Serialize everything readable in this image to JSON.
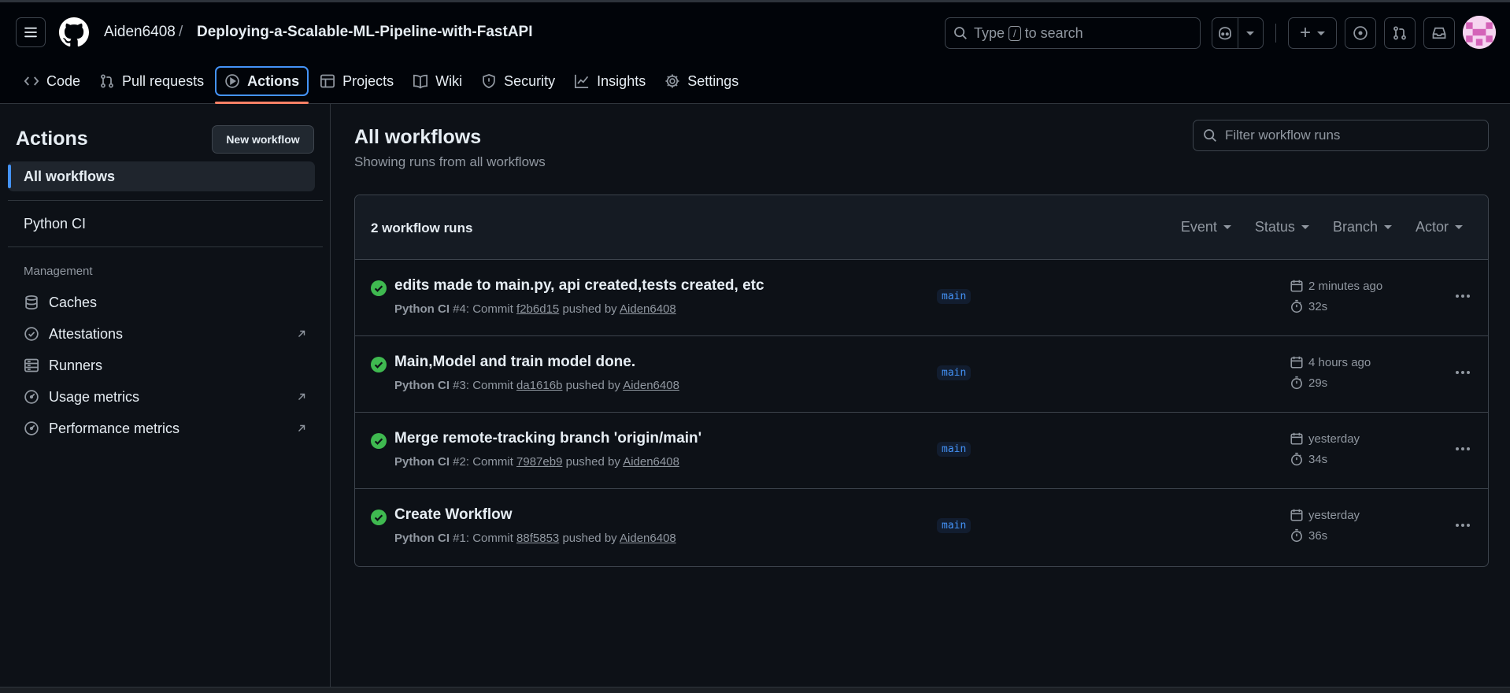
{
  "header": {
    "owner": "Aiden6408",
    "separator": "/",
    "repo": "Deploying-a-Scalable-ML-Pipeline-with-FastAPI",
    "search_type": "Type",
    "search_key": "/",
    "search_suffix": "to search",
    "plus": "+"
  },
  "nav": {
    "code": "Code",
    "pull_requests": "Pull requests",
    "actions": "Actions",
    "projects": "Projects",
    "wiki": "Wiki",
    "security": "Security",
    "insights": "Insights",
    "settings": "Settings"
  },
  "sidebar": {
    "title": "Actions",
    "new_workflow": "New workflow",
    "all_workflows": "All workflows",
    "workflow": "Python CI",
    "management_heading": "Management",
    "management": [
      {
        "label": "Caches"
      },
      {
        "label": "Attestations"
      },
      {
        "label": "Runners"
      },
      {
        "label": "Usage metrics"
      },
      {
        "label": "Performance metrics"
      }
    ]
  },
  "main": {
    "title": "All workflows",
    "subtitle": "Showing runs from all workflows",
    "filter_placeholder": "Filter workflow runs",
    "runs_count": "2 workflow runs",
    "filters": {
      "event": "Event",
      "status": "Status",
      "branch": "Branch",
      "actor": "Actor"
    },
    "runs": [
      {
        "title": "edits made to main.py, api created,tests created, etc",
        "workflow": "Python CI",
        "number": "#4: Commit",
        "sha": "f2b6d15",
        "pushed_by": "pushed by",
        "actor": "Aiden6408",
        "branch": "main",
        "when": "2 minutes ago",
        "duration": "32s"
      },
      {
        "title": "Main,Model and train model done.",
        "workflow": "Python CI",
        "number": "#3: Commit",
        "sha": "da1616b",
        "pushed_by": "pushed by",
        "actor": "Aiden6408",
        "branch": "main",
        "when": "4 hours ago",
        "duration": "29s"
      },
      {
        "title": "Merge remote-tracking branch 'origin/main'",
        "workflow": "Python CI",
        "number": "#2: Commit",
        "sha": "7987eb9",
        "pushed_by": "pushed by",
        "actor": "Aiden6408",
        "branch": "main",
        "when": "yesterday",
        "duration": "34s"
      },
      {
        "title": "Create Workflow",
        "workflow": "Python CI",
        "number": "#1: Commit",
        "sha": "88f5853",
        "pushed_by": "pushed by",
        "actor": "Aiden6408",
        "branch": "main",
        "when": "yesterday",
        "duration": "36s"
      }
    ]
  },
  "colors": {
    "success": "#3fb950",
    "accent": "#4493f8",
    "underline": "#f78166"
  }
}
